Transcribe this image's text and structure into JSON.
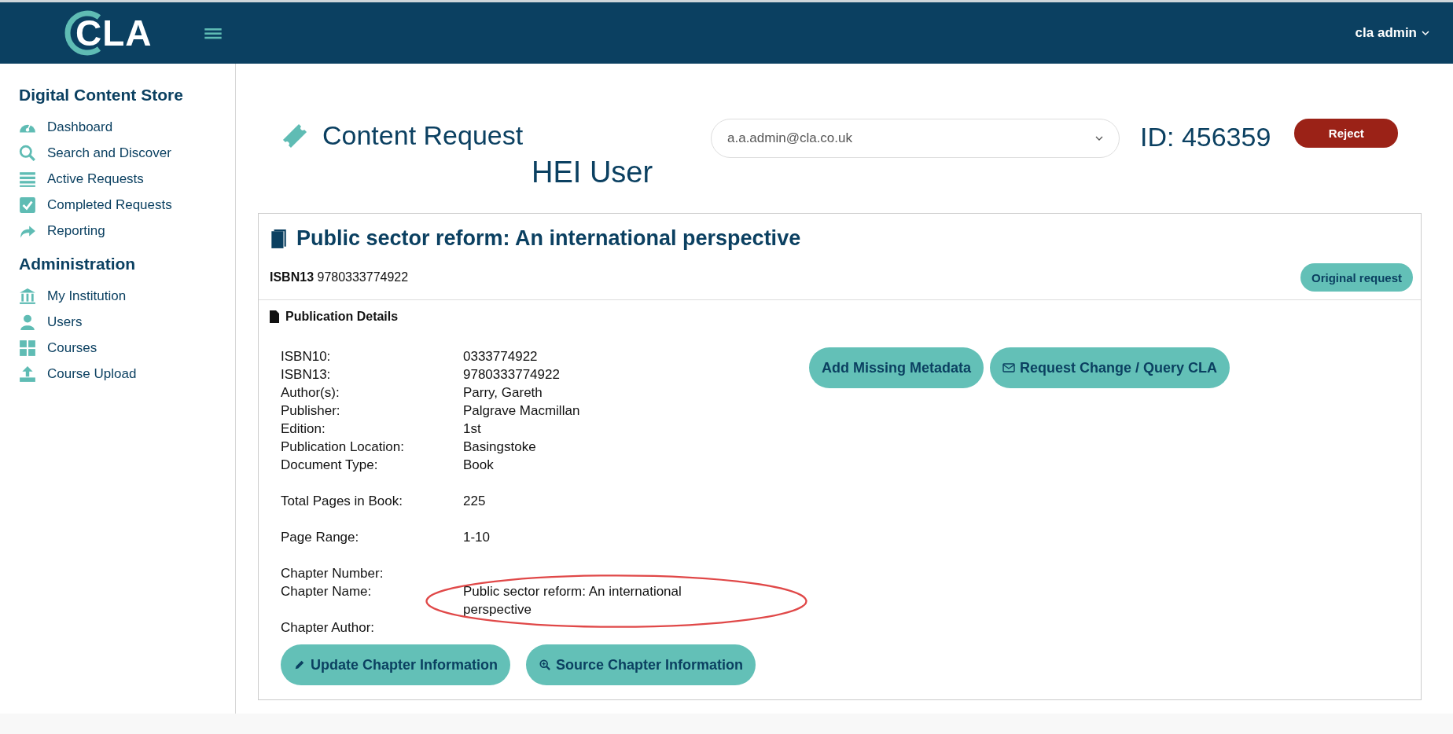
{
  "header": {
    "logo": "CLA",
    "user_menu": "cla admin"
  },
  "sidebar": {
    "sections": [
      {
        "title": "Digital Content Store",
        "items": [
          {
            "label": "Dashboard"
          },
          {
            "label": "Search and Discover"
          },
          {
            "label": "Active Requests"
          },
          {
            "label": "Completed Requests"
          },
          {
            "label": "Reporting"
          }
        ]
      },
      {
        "title": "Administration",
        "items": [
          {
            "label": "My Institution"
          },
          {
            "label": "Users"
          },
          {
            "label": "Courses"
          },
          {
            "label": "Course Upload"
          }
        ]
      }
    ]
  },
  "page": {
    "title": "Content Request",
    "user_select": "a.a.admin@cla.co.uk",
    "user_role": "HEI User",
    "id_label": "ID: 456359",
    "reject_button": "Reject"
  },
  "book": {
    "title": "Public sector reform: An international perspective",
    "isbn_label": "ISBN13",
    "isbn_value": "9780333774922",
    "original_request_button": "Original request",
    "section_title": "Publication Details",
    "detail_groups": [
      [
        {
          "label": "ISBN10:",
          "value": "0333774922"
        },
        {
          "label": "ISBN13:",
          "value": "9780333774922"
        },
        {
          "label": "Author(s):",
          "value": "Parry, Gareth"
        },
        {
          "label": "Publisher:",
          "value": "Palgrave Macmillan"
        },
        {
          "label": "Edition:",
          "value": "1st"
        },
        {
          "label": "Publication Location:",
          "value": "Basingstoke"
        },
        {
          "label": "Document Type:",
          "value": "Book"
        }
      ],
      [
        {
          "label": "Total Pages in Book:",
          "value": "225"
        }
      ],
      [
        {
          "label": "Page Range:",
          "value": "1-10"
        }
      ],
      [
        {
          "label": "Chapter Number:"
        },
        {
          "label": "Chapter Name:",
          "value": "Public sector reform: An international perspective",
          "highlighted": true
        },
        {
          "label": "Chapter Author:"
        }
      ]
    ],
    "side_buttons": [
      "Add Missing Metadata",
      "Request Change / Query CLA"
    ],
    "bottom_buttons": [
      "Update Chapter Information",
      "Source Chapter Information"
    ]
  }
}
